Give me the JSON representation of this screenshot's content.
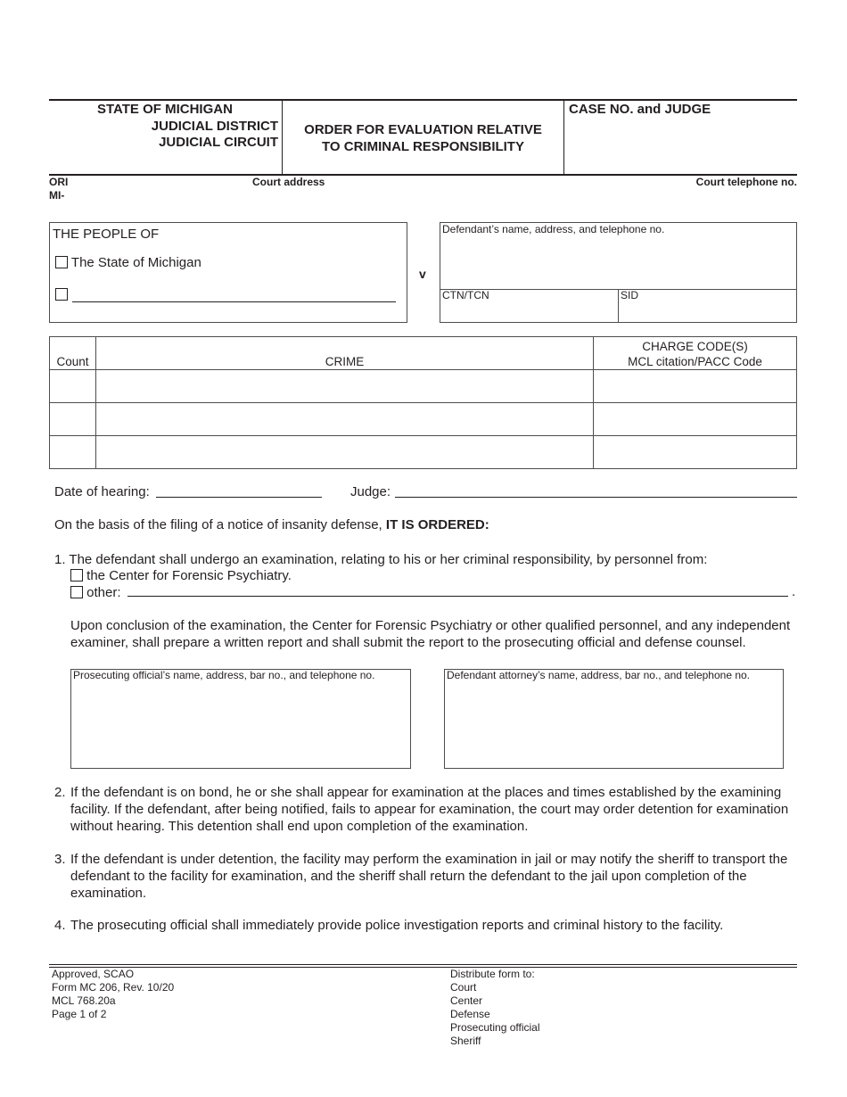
{
  "header": {
    "state": "STATE OF MICHIGAN",
    "district": "JUDICIAL DISTRICT",
    "circuit": "JUDICIAL CIRCUIT",
    "title_line1": "ORDER FOR EVALUATION RELATIVE",
    "title_line2": "TO CRIMINAL RESPONSIBILITY",
    "case_label": "CASE NO. and JUDGE",
    "ori_label": "ORI",
    "ori_prefix": "MI-",
    "court_address_label": "Court address",
    "court_telephone_label": "Court telephone no."
  },
  "parties": {
    "people_title": "THE PEOPLE OF",
    "option_state": "The State of Michigan",
    "option_other_value": "",
    "versus": "v",
    "defendant_label": "Defendant’s name, address, and telephone no.",
    "ctn_label": "CTN/TCN",
    "sid_label": "SID"
  },
  "crime_table": {
    "headers": {
      "count": "Count",
      "crime": "CRIME",
      "code_line1": "CHARGE CODE(S)",
      "code_line2": "MCL citation/PACC Code"
    },
    "rows": [
      {
        "count": "",
        "crime": "",
        "code": ""
      },
      {
        "count": "",
        "crime": "",
        "code": ""
      },
      {
        "count": "",
        "crime": "",
        "code": ""
      }
    ]
  },
  "hearing": {
    "date_label": "Date of hearing:",
    "date_value": "",
    "judge_label": "Judge:",
    "judge_value": ""
  },
  "order": {
    "basis_text": "On the basis of the filing of a notice of insanity defense,",
    "basis_bold": "IT IS ORDERED:",
    "items": [
      {
        "num": "1.",
        "text": "The defendant shall undergo an examination, relating to his or her criminal responsibility, by personnel from:"
      },
      {
        "num": "2.",
        "text": "If the defendant is on bond, he or she shall appear for examination at the places and times established by the examining facility. If the defendant, after being notified, fails to appear for examination, the court may order detention for examination without hearing. This detention shall end upon completion of the examination."
      },
      {
        "num": "3.",
        "text": "If the defendant is under detention, the facility may perform the examination in jail or may notify the sheriff to transport the defendant to the facility for examination, and the sheriff shall return the defendant to the jail upon completion of the examination."
      },
      {
        "num": "4.",
        "text": "The prosecuting official shall immediately provide police investigation reports and criminal history to the facility."
      }
    ],
    "option_center": "the Center for Forensic Psychiatry.",
    "option_other_label": "other:",
    "option_other_value": "",
    "option_other_end": ".",
    "conclusion": "Upon conclusion of the examination, the Center for Forensic Psychiatry or other qualified personnel, and any independent examiner, shall prepare a written report and shall submit the report to the prosecuting official and defense counsel.",
    "prosecutor_label": "Prosecuting official’s name, address, bar no., and telephone no.",
    "defense_attorney_label": "Defendant attorney’s name, address, bar no., and telephone no."
  },
  "footer": {
    "left": [
      "Approved, SCAO",
      "Form MC 206, Rev. 10/20",
      "MCL 768.20a",
      "Page 1 of 2"
    ],
    "distribute_label": "Distribute form to:",
    "distribute": [
      "Court",
      "Center",
      "Defense",
      "Prosecuting official",
      "Sheriff"
    ]
  }
}
